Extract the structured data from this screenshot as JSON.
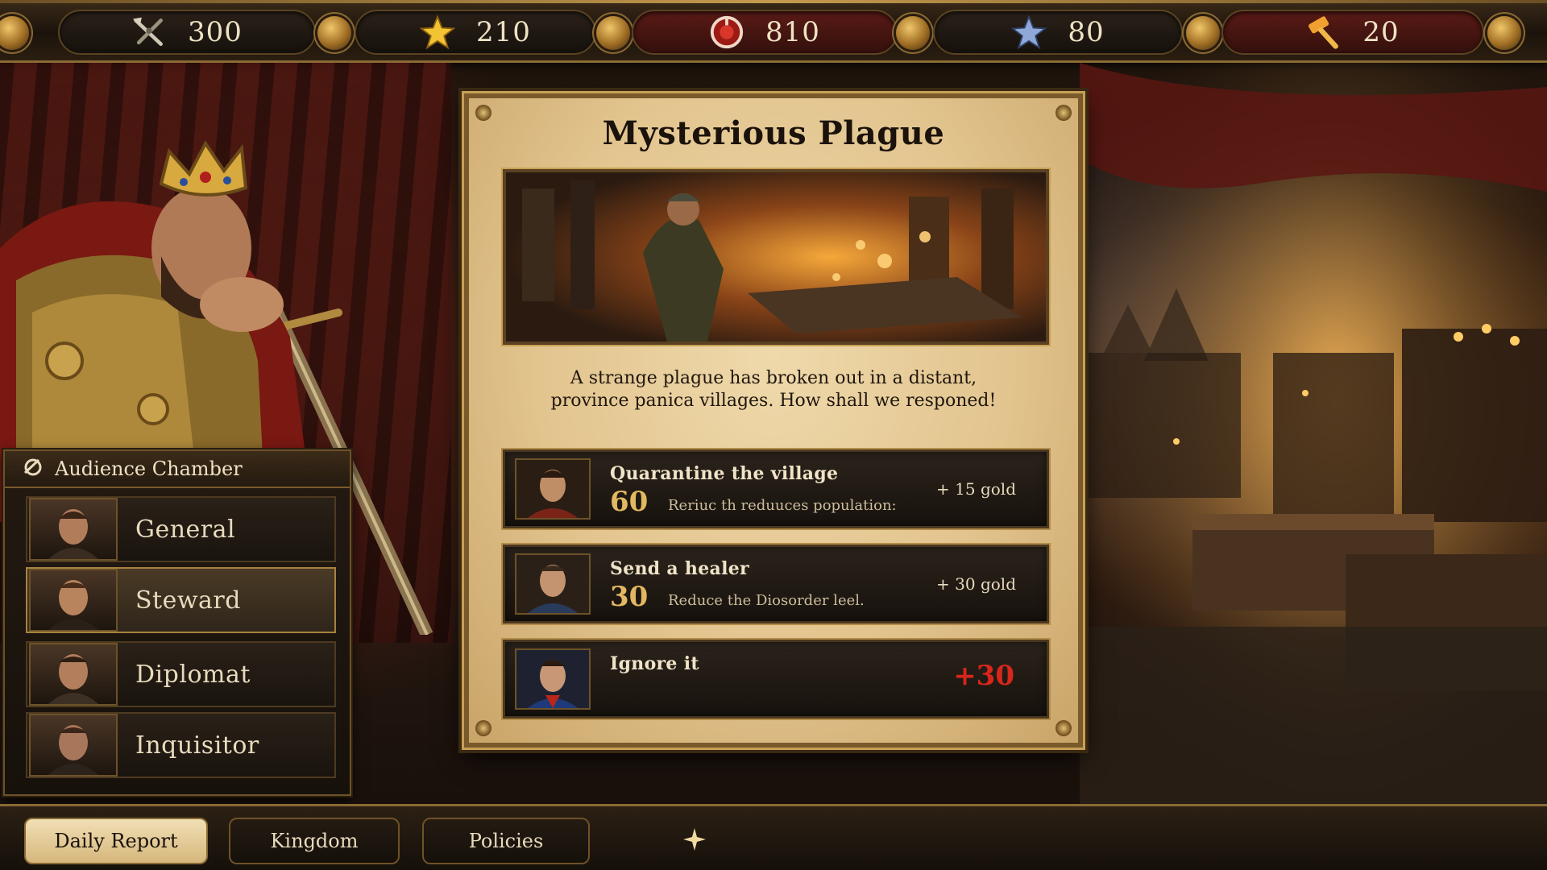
{
  "resources": [
    {
      "icon": "crossed-tools-icon",
      "value": "300",
      "style": "dark"
    },
    {
      "icon": "gold-star-icon",
      "value": "210",
      "style": "dark"
    },
    {
      "icon": "red-orb-icon",
      "value": "810",
      "style": "red"
    },
    {
      "icon": "blue-star-icon",
      "value": "80",
      "style": "dark"
    },
    {
      "icon": "hammer-icon",
      "value": "20",
      "style": "red"
    }
  ],
  "chamber": {
    "title": "Audience Chamber",
    "advisors": [
      {
        "name": "General",
        "active": false
      },
      {
        "name": "Steward",
        "active": true
      },
      {
        "name": "Diplomat",
        "active": false
      },
      {
        "name": "Inquisitor",
        "active": false
      }
    ]
  },
  "event": {
    "title": "Mysterious Plague",
    "description_line1": "A strange plague has broken out in a distant,",
    "description_line2": "province panica villages. How shall we responed!",
    "options": [
      {
        "title": "Quarantine the village",
        "cost": "60",
        "desc": "Reriuc th reduuces population:",
        "reward": "+ 15 gold"
      },
      {
        "title": "Send a healer",
        "cost": "30",
        "desc": "Reduce the Diosorder leel.",
        "reward": "+ 30 gold"
      },
      {
        "title": "Ignore it",
        "cost": "",
        "desc": "",
        "reward": "+30"
      }
    ]
  },
  "tabs": [
    {
      "label": "Daily Report",
      "active": true
    },
    {
      "label": "Kingdom",
      "active": false
    },
    {
      "label": "Policies",
      "active": false
    }
  ],
  "colors": {
    "gold": "#e2b861",
    "penalty_red": "#d8261c",
    "parchment": "#e2c48e"
  }
}
